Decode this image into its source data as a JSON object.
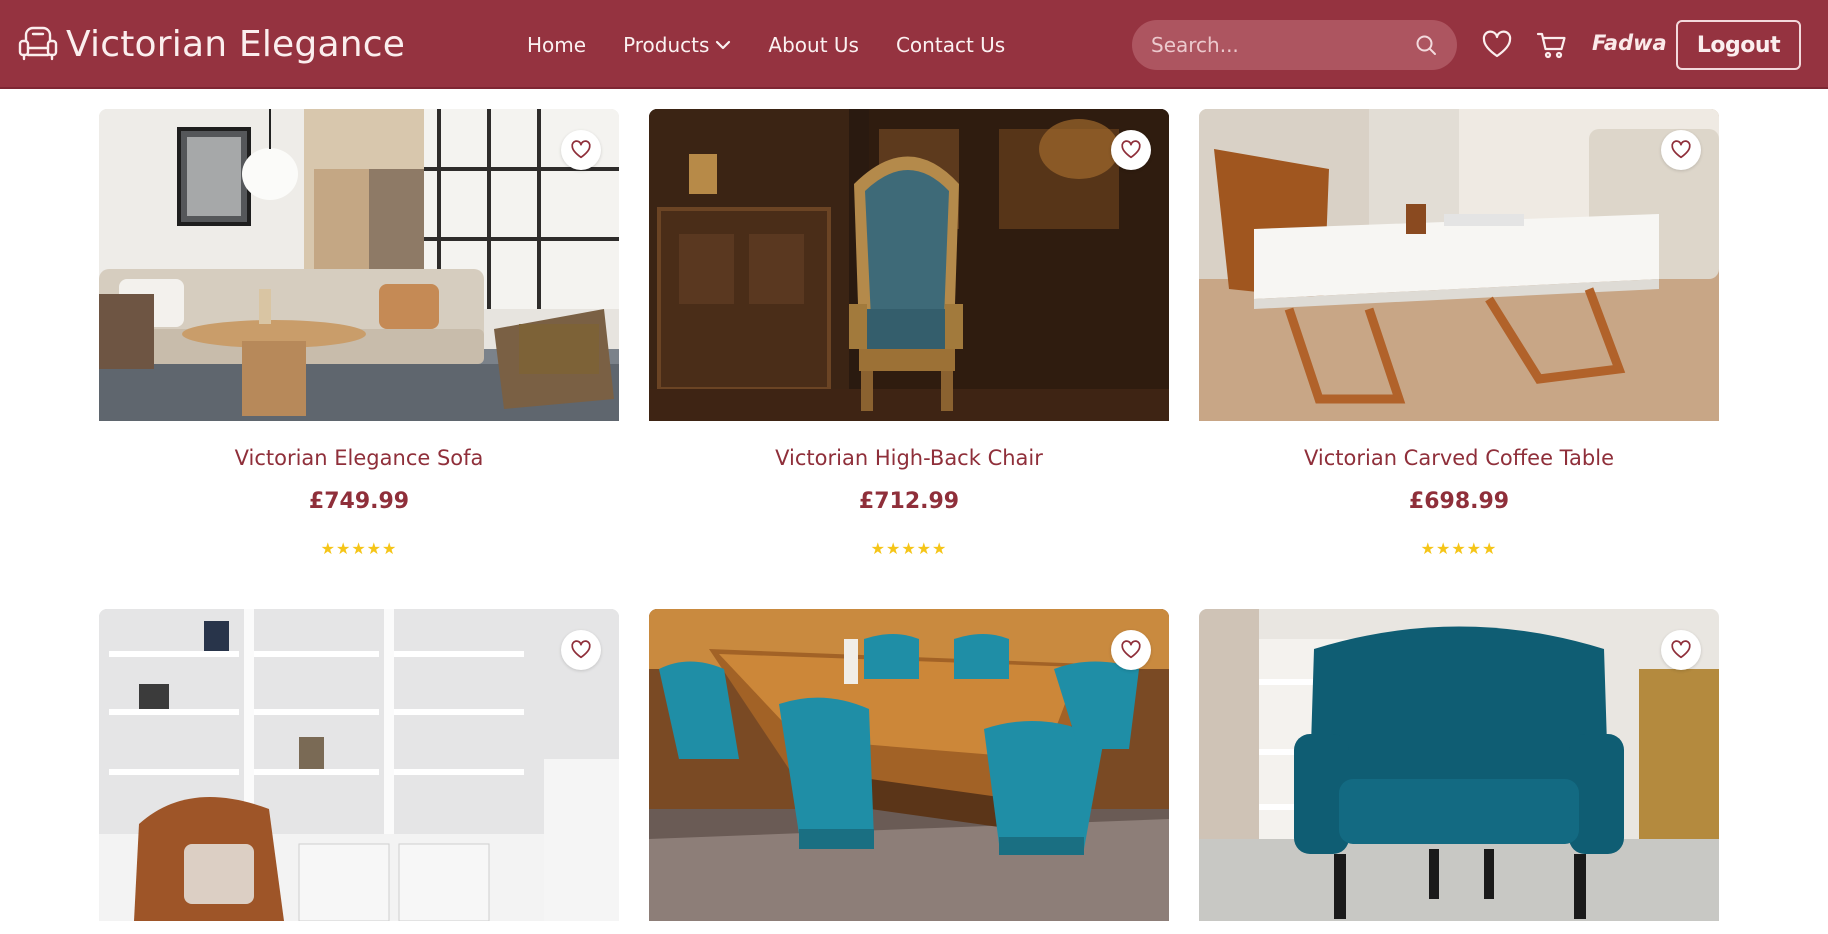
{
  "brand": {
    "title": "Victorian Elegance",
    "logo_icon": "armchair-icon"
  },
  "nav": {
    "home": "Home",
    "products": "Products",
    "about": "About Us",
    "contact": "Contact Us"
  },
  "search": {
    "placeholder": "Search...",
    "value": ""
  },
  "user": {
    "name": "Fadwa",
    "logout_label": "Logout"
  },
  "colors": {
    "brand": "#953340",
    "accent_text": "#8f2f3a",
    "star": "#f5c518"
  },
  "products": [
    {
      "name": "Victorian Elegance Sofa",
      "price": "£749.99",
      "rating": "★★★★★",
      "rating_value": 5,
      "image": "living-room-sofa"
    },
    {
      "name": "Victorian High-Back Chair",
      "price": "£712.99",
      "rating": "★★★★★",
      "rating_value": 5,
      "image": "carved-blue-chair"
    },
    {
      "name": "Victorian Carved Coffee Table",
      "price": "£698.99",
      "rating": "★★★★★",
      "rating_value": 5,
      "image": "white-coffee-table"
    },
    {
      "image": "leather-wingback-shelves"
    },
    {
      "image": "teal-dining-set"
    },
    {
      "image": "teal-armchair"
    }
  ]
}
